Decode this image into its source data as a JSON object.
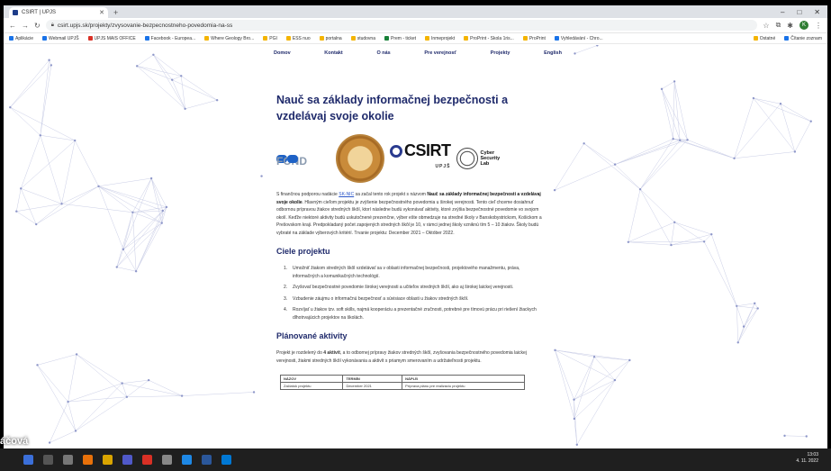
{
  "browser": {
    "tab_title": "CSIRT | UPJS",
    "new_tab": "+",
    "window_controls": [
      "–",
      "□",
      "✕"
    ],
    "url": "csirt.upjs.sk/projekty/zvysovanie-bezpecnostneho-povedomia-na-ss",
    "bookmarks": [
      "Aplikácie",
      "Webmail UPJŠ",
      "UPJS MAIS OFFICE",
      "Facebook - Europea...",
      "Where Geology Bro...",
      "PGI",
      "ESS nuo",
      "portalna",
      "studovna",
      "Prem - ticket",
      "Inmeprojekt",
      "ProPrint - Skola 1ris...",
      "ProPrint",
      "Vyhledávání - Chro..."
    ],
    "bookmarks_right": [
      "Ostatné",
      "Čítanie zoznam"
    ]
  },
  "nav": [
    "Domov",
    "Kontakt",
    "O nás",
    "Pre verejnosť",
    "Projekty",
    "English"
  ],
  "content": {
    "title": "Nauč sa základy informačnej bezpečnosti a vzdelávaj svoje okolie",
    "logos": {
      "fond": "FOND",
      "csirt": "CSIRT",
      "csirt_sub": "UPJŠ",
      "lab": "Cyber Security Lab"
    },
    "intro_before": "S finančnou podporou nadácie ",
    "intro_link": "SK-NIC",
    "intro_mid": " sa začal tento rok projekt s názvom ",
    "intro_bold": "Nauč sa základy informačnej bezpečnosti a vzdelávaj svoje okolie",
    "intro_after": ". Hlavným cieľom projektu je zvýšenie bezpečnostného povedomia u širokej verejnosti. Tento cieľ chceme dosiahnuť odbornou prípravou žiakov stredných škôl, ktorí následne budú vykonávať aktivity, ktoré zvýšia bezpečnostné povedomie vo svojom okolí. Keďže niektoré aktivity budú uskutočnené prezenčne, výber ešte obmedzuje na stredné školy v Banskobystrickom, Košickom a Prešovskom kraji. Predpokladaný počet zapojených stredných škôl je 10, v rámci jednej školy vzniknú tím 5 – 10 žiakov. Školy budú vybraté na základe výberových kritérií. Trvanie projektu: December 2021 – Október 2022.",
    "goals_heading": "Ciele projektu",
    "goals": [
      "Umožniť žiakom stredných škôl vzdelávať sa v oblasti informačnej bezpečnosti, projektového manažmentu, práva, informačných a komunikačných technológií.",
      "Zvyšovať bezpečnostné povedomie širokej verejnosti a učiteľov stredných škôl, ako aj širokej laickej verejnosti.",
      "Vzbudenie záujmu o informačnú bezpečnosť a súvisiace oblasti u žiakov stredných škôl.",
      "Rozvíjať u žiakov tzv. soft skills, najmä kooperáciu a prezentačné zručnosti, potrebné pre tímovú prácu pri riešení žiackych dlhotrvajúcich projektov na školách."
    ],
    "activities_heading": "Plánované aktivity",
    "activities_text_before": "Projekt je rozdelený do ",
    "activities_bold": "4 aktivít",
    "activities_text_after": ", a to odbornej prípravy žiakov stredných škôl, zvyšovania bezpečnostného povedomia laickej verejnosti, žiakmi stredných škôl vykonávania a aktivít s priamym smerovaním a udržateľnosti projektu.",
    "table_headers": [
      "NÁZOV",
      "TERMÍN",
      "NÁPLŇ"
    ],
    "table_rows": [
      [
        "Začiatok projektu",
        "December 2021",
        "Príprava plánu pre realizáciu projektu"
      ]
    ]
  },
  "taskbar": {
    "time": "13:03",
    "date": "4. 11. 2022",
    "caption": "áčová"
  },
  "colors": {
    "heading": "#1f2a6b",
    "link": "#2b56c9",
    "taskbar": "#1f1f1f"
  }
}
